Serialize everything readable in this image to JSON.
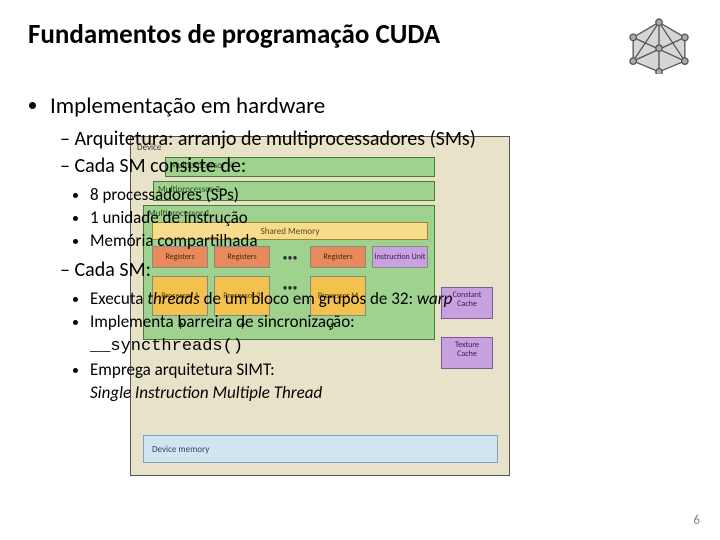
{
  "title": "Fundamentos de programação CUDA",
  "icon": "cuda-polyhedron-icon",
  "l1": {
    "a": "Implementação em hardware"
  },
  "l2": {
    "a": "Arquitetura: arranjo de multiprocessadores (SMs)",
    "b": "Cada SM consiste de:",
    "c": "Cada SM:"
  },
  "sm_consists": {
    "a": "8 processadores (SPs)",
    "b": "1 unidade de instrução",
    "c": "Memória compartilhada"
  },
  "sm_does": {
    "a_prefix": "Executa ",
    "a_italic": "threads",
    "a_mid": " de um bloco em grupos de 32: ",
    "a_warp": "warp",
    "b_text": "Implementa barreira de sincronização:",
    "b_code": "__syncthreads()",
    "c_text": "Emprega arquitetura SIMT:",
    "c_italic": "Single Instruction Multiple Thread"
  },
  "diagram": {
    "device": "Device",
    "mp_n": "Multiprocessor N",
    "mp_2": "Multiprocessor 2",
    "mp_1": "Multiprocessor 1",
    "shared": "Shared Memory",
    "reg": "Registers",
    "iu": "Instruction Unit",
    "p1": "Processor 1",
    "p2": "Processor 2",
    "pdots": "•••",
    "pm": "Processor M",
    "ccache": "Constant Cache",
    "tcache": "Texture Cache",
    "devmem": "Device memory"
  },
  "page": "6"
}
